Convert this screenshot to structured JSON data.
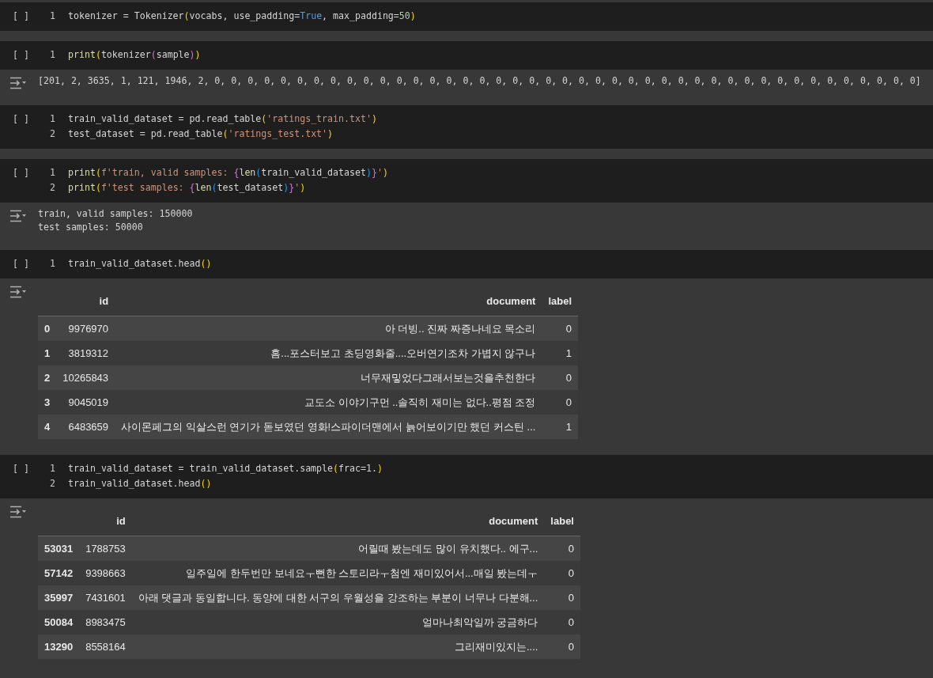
{
  "cells": [
    {
      "run_button": "[ ]",
      "lines": [
        {
          "number": "1",
          "tokens": [
            {
              "text": "tokenizer = Tokenizer",
              "kind": "plain"
            },
            {
              "text": "(",
              "kind": "bracket1"
            },
            {
              "text": "vocabs, use_padding=",
              "kind": "plain"
            },
            {
              "text": "True",
              "kind": "constant"
            },
            {
              "text": ", max_padding=",
              "kind": "plain"
            },
            {
              "text": "50",
              "kind": "number"
            },
            {
              "text": ")",
              "kind": "bracket1"
            }
          ]
        }
      ]
    },
    {
      "run_button": "[ ]",
      "lines": [
        {
          "number": "1",
          "tokens": [
            {
              "text": "print",
              "kind": "function"
            },
            {
              "text": "(",
              "kind": "bracket1"
            },
            {
              "text": "tokenizer",
              "kind": "plain"
            },
            {
              "text": "(",
              "kind": "bracket2"
            },
            {
              "text": "sample",
              "kind": "plain"
            },
            {
              "text": ")",
              "kind": "bracket2"
            },
            {
              "text": ")",
              "kind": "bracket1"
            }
          ]
        }
      ],
      "output": {
        "kind": "text",
        "lines": [
          "[201, 2, 3635, 1, 121, 1946, 2, 0, 0, 0, 0, 0, 0, 0, 0, 0, 0, 0, 0, 0, 0, 0, 0, 0, 0, 0, 0, 0, 0, 0, 0, 0, 0, 0, 0, 0, 0, 0, 0, 0, 0, 0, 0, 0, 0, 0, 0, 0, 0, 0]"
        ]
      }
    },
    {
      "run_button": "[ ]",
      "lines": [
        {
          "number": "1",
          "tokens": [
            {
              "text": "train_valid_dataset = pd.read_table",
              "kind": "plain"
            },
            {
              "text": "(",
              "kind": "bracket1"
            },
            {
              "text": "'ratings_train.txt'",
              "kind": "string"
            },
            {
              "text": ")",
              "kind": "bracket1"
            }
          ]
        },
        {
          "number": "2",
          "tokens": [
            {
              "text": "test_dataset = pd.read_table",
              "kind": "plain"
            },
            {
              "text": "(",
              "kind": "bracket1"
            },
            {
              "text": "'ratings_test.txt'",
              "kind": "string"
            },
            {
              "text": ")",
              "kind": "bracket1"
            }
          ]
        }
      ]
    },
    {
      "run_button": "[ ]",
      "lines": [
        {
          "number": "1",
          "tokens": [
            {
              "text": "print",
              "kind": "function"
            },
            {
              "text": "(",
              "kind": "bracket1"
            },
            {
              "text": "f'train, valid samples: ",
              "kind": "string"
            },
            {
              "text": "{",
              "kind": "bracket2"
            },
            {
              "text": "len",
              "kind": "function"
            },
            {
              "text": "(",
              "kind": "bracket3"
            },
            {
              "text": "train_valid_dataset",
              "kind": "plain"
            },
            {
              "text": ")",
              "kind": "bracket3"
            },
            {
              "text": "}",
              "kind": "bracket2"
            },
            {
              "text": "'",
              "kind": "string"
            },
            {
              "text": ")",
              "kind": "bracket1"
            }
          ]
        },
        {
          "number": "2",
          "tokens": [
            {
              "text": "print",
              "kind": "function"
            },
            {
              "text": "(",
              "kind": "bracket1"
            },
            {
              "text": "f'test samples: ",
              "kind": "string"
            },
            {
              "text": "{",
              "kind": "bracket2"
            },
            {
              "text": "len",
              "kind": "function"
            },
            {
              "text": "(",
              "kind": "bracket3"
            },
            {
              "text": "test_dataset",
              "kind": "plain"
            },
            {
              "text": ")",
              "kind": "bracket3"
            },
            {
              "text": "}",
              "kind": "bracket2"
            },
            {
              "text": "'",
              "kind": "string"
            },
            {
              "text": ")",
              "kind": "bracket1"
            }
          ]
        }
      ],
      "output": {
        "kind": "text",
        "lines": [
          "train, valid samples: 150000",
          "test samples: 50000"
        ]
      }
    },
    {
      "run_button": "[ ]",
      "lines": [
        {
          "number": "1",
          "tokens": [
            {
              "text": "train_valid_dataset.head",
              "kind": "plain"
            },
            {
              "text": "()",
              "kind": "bracket1"
            }
          ]
        }
      ],
      "output": {
        "kind": "table",
        "columns": [
          "id",
          "document",
          "label"
        ],
        "rows": [
          {
            "index": "0",
            "id": "9976970",
            "document": "아 더빙.. 진짜 짜증나네요 목소리",
            "label": "0"
          },
          {
            "index": "1",
            "id": "3819312",
            "document": "흠...포스터보고 초딩영화줄....오버연기조차 가볍지 않구나",
            "label": "1"
          },
          {
            "index": "2",
            "id": "10265843",
            "document": "너무재밓었다그래서보는것을추천한다",
            "label": "0"
          },
          {
            "index": "3",
            "id": "9045019",
            "document": "교도소 이야기구먼 ..솔직히 재미는 없다..평점 조정",
            "label": "0"
          },
          {
            "index": "4",
            "id": "6483659",
            "document": "사이몬페그의 익살스런 연기가 돋보였던 영화!스파이더맨에서 늙어보이기만 했던 커스틴 ...",
            "label": "1"
          }
        ]
      }
    },
    {
      "run_button": "[ ]",
      "lines": [
        {
          "number": "1",
          "tokens": [
            {
              "text": "train_valid_dataset = train_valid_dataset.sample",
              "kind": "plain"
            },
            {
              "text": "(",
              "kind": "bracket1"
            },
            {
              "text": "frac=1.",
              "kind": "plain"
            },
            {
              "text": ")",
              "kind": "bracket1"
            }
          ]
        },
        {
          "number": "2",
          "tokens": [
            {
              "text": "train_valid_dataset.head",
              "kind": "plain"
            },
            {
              "text": "()",
              "kind": "bracket1"
            }
          ]
        }
      ],
      "output": {
        "kind": "table",
        "columns": [
          "id",
          "document",
          "label"
        ],
        "rows": [
          {
            "index": "53031",
            "id": "1788753",
            "document": "어릴때 봤는데도 많이 유치했다.. 에구...",
            "label": "0"
          },
          {
            "index": "57142",
            "id": "9398663",
            "document": "일주일에 한두번만 보네요ㅜ뻔한 스토리라ㅜ첨엔 재미있어서...매일 봤는데ㅜ",
            "label": "0"
          },
          {
            "index": "35997",
            "id": "7431601",
            "document": "아래 댓글과 동일합니다. 동양에 대한 서구의 우월성을 강조하는 부분이 너무나 다분해...",
            "label": "0"
          },
          {
            "index": "50084",
            "id": "8983475",
            "document": "얼마나최악일까 궁금하다",
            "label": "0"
          },
          {
            "index": "13290",
            "id": "8558164",
            "document": "그리재미있지는....",
            "label": "0"
          }
        ]
      }
    }
  ]
}
